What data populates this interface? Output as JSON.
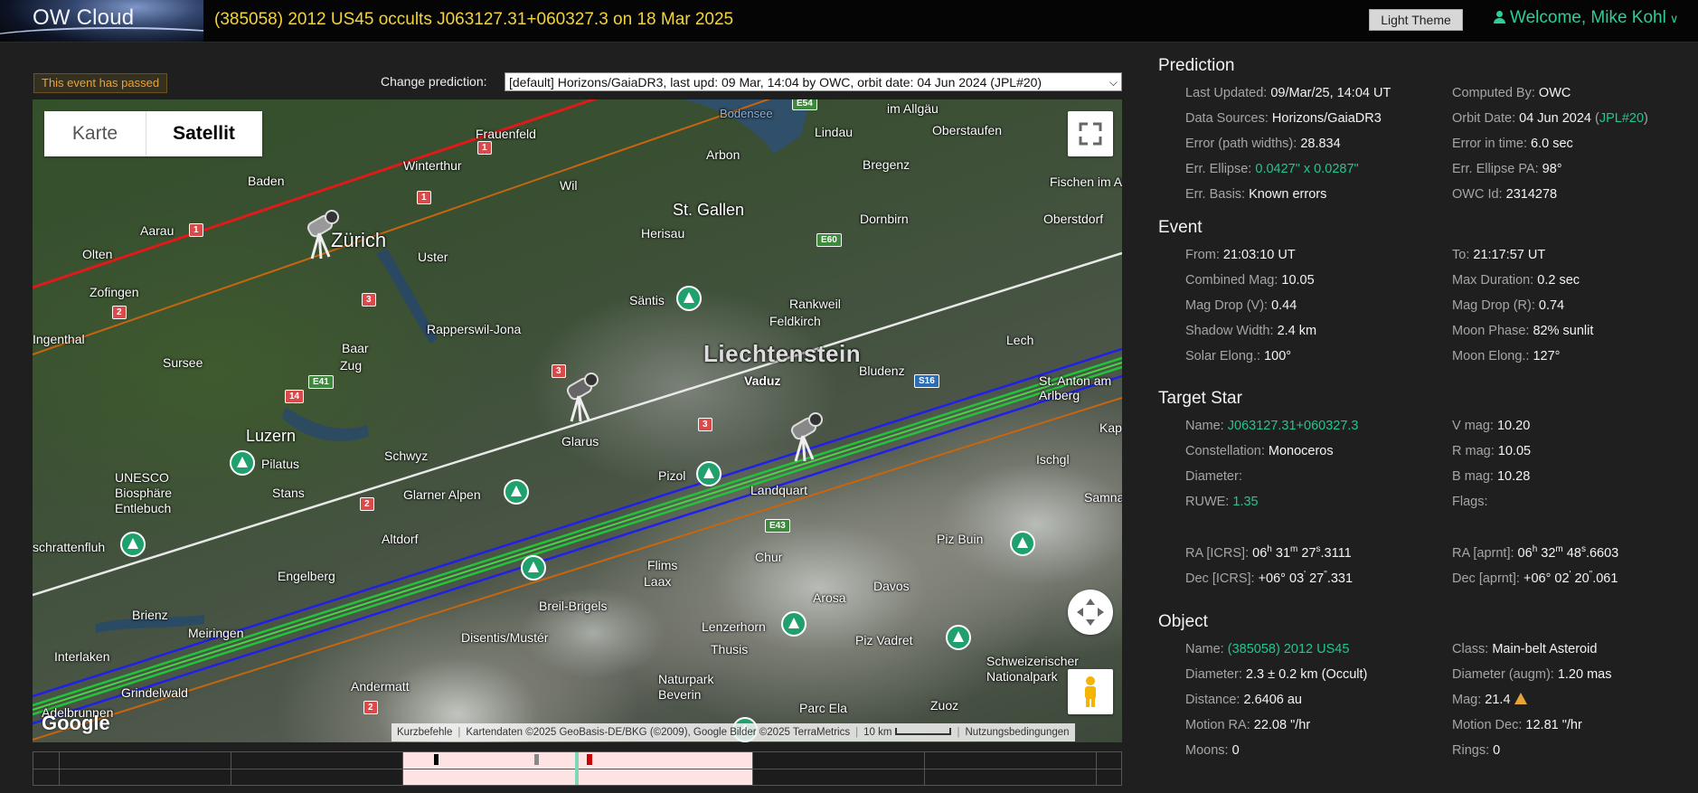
{
  "header": {
    "logo": "OW Cloud",
    "title": "(385058) 2012 US45 occults J063127.31+060327.3 on 18 Mar 2025",
    "theme_button": "Light Theme",
    "welcome": "Welcome, Mike Kohl"
  },
  "toolbar": {
    "passed_badge": "This event has passed",
    "change_label": "Change prediction:",
    "change_value": "[default] Horizons/GaiaDR3, last upd: 09 Mar, 14:04 by OWC, orbit date: 04 Jun 2024 (JPL#20)"
  },
  "map": {
    "type_karte": "Karte",
    "type_satellit": "Satellit",
    "google": "Google",
    "attribution": {
      "shortcuts": "Kurzbefehle",
      "data": "Kartendaten ©2025 GeoBasis-DE/BKG (©2009), Google Bilder ©2025 TerraMetrics",
      "scale": "10 km",
      "terms": "Nutzungsbedingungen"
    },
    "places": [
      "Frauenfeld",
      "Bodensee",
      "Lindau",
      "Oberstaufen",
      "im Allgäu",
      "Arbon",
      "Winterthur",
      "Baden",
      "Bregenz",
      "Wil",
      "Fischen im Allgäu",
      "St. Gallen",
      "Aarau",
      "Zürich",
      "Herisau",
      "Dornbirn",
      "Oberstdorf",
      "Olten",
      "Uster",
      "Zofingen",
      "Säntis",
      "Rankweil",
      "Feldkirch",
      "Rapperswil-Jona",
      "Sursee",
      "Baar",
      "Zug",
      "Liechtenstein",
      "Vaduz",
      "Bludenz",
      "Lech",
      "St. Anton am Arlberg",
      "Luzern",
      "Schwyz",
      "Glarus",
      "Pilatus",
      "Pizol",
      "Landquart",
      "UNESCO Biosphäre Entlebuch",
      "Stans",
      "Glarner Alpen",
      "Altdorf",
      "Chur",
      "Piz Buin",
      "Engelberg",
      "Flims",
      "Laax",
      "Davos",
      "Brienz",
      "Breil-Brigels",
      "Arosa",
      "Disentis/Mustér",
      "Lenzerhorn",
      "Thusis",
      "Piz Vadret",
      "Schweizerischer Nationalpark",
      "Interlaken",
      "Grindelwald",
      "Andermatt",
      "Naturpark Beverin",
      "Parc Ela",
      "Zuoz",
      "Meiringen",
      "Ischgl",
      "Samnaun",
      "Kap",
      "Adelbrunnen",
      "schrattenfluh",
      "Ingenthal"
    ],
    "routes": [
      "1",
      "1",
      "1",
      "2",
      "3",
      "3",
      "3",
      "14",
      "2",
      "2",
      "E41",
      "E43",
      "E60",
      "E54",
      "S16"
    ]
  },
  "panel": {
    "prediction": {
      "heading": "Prediction",
      "rows": [
        {
          "k": "Last Updated:",
          "v": "09/Mar/25, 14:04 UT"
        },
        {
          "k": "Computed By:",
          "v": "OWC"
        },
        {
          "k": "Data Sources:",
          "v": "Horizons/GaiaDR3"
        },
        {
          "k": "Orbit Date:",
          "v": "04 Jun 2024",
          "v2": "JPL#20"
        },
        {
          "k": "Error (path widths):",
          "v": "28.834"
        },
        {
          "k": "Error in time:",
          "v": "6.0 sec"
        },
        {
          "k": "Err. Ellipse:",
          "v": "0.0427\" x 0.0287\""
        },
        {
          "k": "Err. Ellipse PA:",
          "v": "98°"
        },
        {
          "k": "Err. Basis:",
          "v": "Known errors"
        },
        {
          "k": "OWC Id:",
          "v": "2314278"
        }
      ]
    },
    "event": {
      "heading": "Event",
      "rows": [
        {
          "k": "From:",
          "v": "21:03:10 UT"
        },
        {
          "k": "To:",
          "v": "21:17:57 UT"
        },
        {
          "k": "Combined Mag:",
          "v": "10.05"
        },
        {
          "k": "Max Duration:",
          "v": "0.2 sec"
        },
        {
          "k": "Mag Drop (V):",
          "v": "0.44"
        },
        {
          "k": "Mag Drop (R):",
          "v": "0.74"
        },
        {
          "k": "Shadow Width:",
          "v": "2.4 km"
        },
        {
          "k": "Moon Phase:",
          "v": "82% sunlit"
        },
        {
          "k": "Solar Elong.:",
          "v": "100°"
        },
        {
          "k": "Moon Elong.:",
          "v": "127°"
        }
      ]
    },
    "target": {
      "heading": "Target Star",
      "rows": [
        {
          "k": "Name:",
          "v": "J063127.31+060327.3"
        },
        {
          "k": "V mag:",
          "v": "10.20"
        },
        {
          "k": "Constellation:",
          "v": "Monoceros"
        },
        {
          "k": "R mag:",
          "v": "10.05"
        },
        {
          "k": "Diameter:",
          "v": ""
        },
        {
          "k": "B mag:",
          "v": "10.28"
        },
        {
          "k": "RUWE:",
          "v": "1.35"
        },
        {
          "k": "Flags:",
          "v": ""
        }
      ],
      "ra_icrs": {
        "k": "RA [ICRS]:",
        "h": "06",
        "m": "31",
        "s": "27",
        "frac": ".3111"
      },
      "ra_aprnt": {
        "k": "RA [aprnt]:",
        "h": "06",
        "m": "32",
        "s": "48",
        "frac": ".6603"
      },
      "dec_icrs": {
        "k": "Dec [ICRS]:",
        "d": "+06°",
        "m": "03",
        "s": "27",
        "frac": ".331"
      },
      "dec_aprnt": {
        "k": "Dec [aprnt]:",
        "d": "+06°",
        "m": "02",
        "s": "20",
        "frac": ".061"
      }
    },
    "object": {
      "heading": "Object",
      "rows": [
        {
          "k": "Name:",
          "v": "(385058) 2012 US45"
        },
        {
          "k": "Class:",
          "v": "Main-belt Asteroid"
        },
        {
          "k": "Diameter:",
          "v": "2.3 ± 0.2 km",
          "v2": "(Occult)"
        },
        {
          "k": "Diameter (augm):",
          "v": "1.20 mas"
        },
        {
          "k": "Distance:",
          "v": "2.6406 au"
        },
        {
          "k": "Mag:",
          "v": "21.4"
        },
        {
          "k": "Motion RA:",
          "v": "22.08 \"/hr"
        },
        {
          "k": "Motion Dec:",
          "v": "12.81 \"/hr"
        },
        {
          "k": "Moons:",
          "v": "0"
        },
        {
          "k": "Rings:",
          "v": "0"
        }
      ]
    }
  }
}
